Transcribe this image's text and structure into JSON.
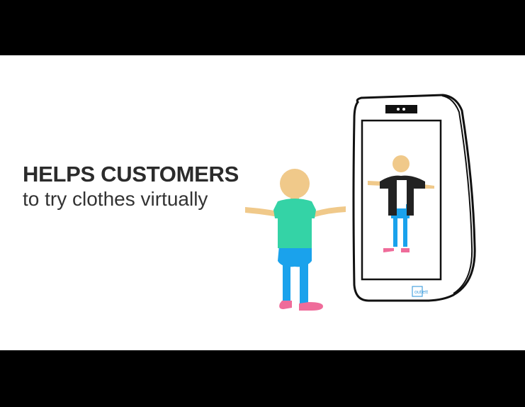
{
  "slide": {
    "headline_bold": "HELPS CUSTOMERS",
    "headline_light": "to try clothes virtually",
    "kiosk_logo_text": "outlett"
  },
  "colors": {
    "letterbox": "#000000",
    "background": "#ffffff",
    "text": "#2b2b2b",
    "skin": "#f0c98a",
    "shirt": "#34d3a6",
    "shorts": "#1aa2ec",
    "legs": "#1aa2ec",
    "shoes": "#ef6c9a",
    "jacket": "#222222",
    "kiosk_outline": "#111111",
    "logo_accent": "#4aa3df"
  },
  "icons": [
    "person-figure-icon",
    "kiosk-mirror-icon",
    "camera-icon",
    "brand-logo-icon"
  ]
}
